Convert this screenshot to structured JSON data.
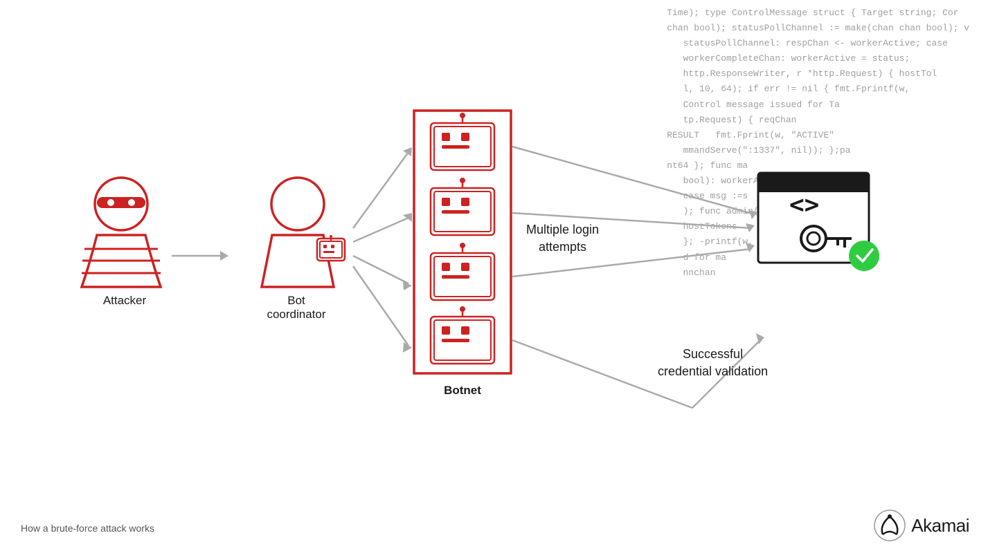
{
  "code_lines": [
    "Time); type ControlMessage struct { Target string; Cor",
    "chan bool); statusPollChannel := make(chan chan bool); v",
    "   statusPollChannel: respChan <- workerActive; case",
    "   workerCompleteChan: workerActive = status;",
    "   http.ResponseWriter, r *http.Request) { hostTol",
    "   l, 10, 64); if err != nil { fmt.Fprintf(w,",
    "   Control message issued for Ta",
    "   tp.Request) { reqChan",
    "RESULT   fmt.Fprint(w, \"ACTIVE\"",
    "   mmandServe(\":1337\", nil)); };pa",
    "nt64 }; func ma",
    "   bool): workerApt",
    "   case msg :=s",
    "   ); func admin(",
    "   hostTokens",
    "   }; -printf(w,",
    "   d for ma",
    "   nnchan"
  ],
  "attacker": {
    "label": "Attacker"
  },
  "coordinator": {
    "label": "Bot\ncoordinator"
  },
  "botnet": {
    "label": "Botnet"
  },
  "login_attempts": {
    "label": "Multiple login\nattempts"
  },
  "credential": {
    "label": "Successful\ncredential validation"
  },
  "footer": {
    "label": "How a brute-force attack works"
  },
  "akamai": {
    "label": "Akamai"
  },
  "colors": {
    "red": "#cc2222",
    "gray_arrow": "#aaaaaa",
    "dark": "#1a1a1a"
  }
}
